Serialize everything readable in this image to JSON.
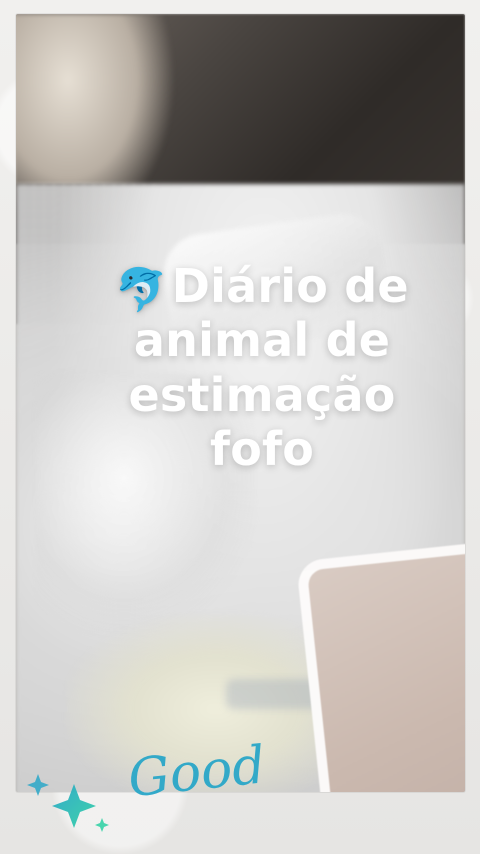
{
  "overlay": {
    "icon_name": "dolphin-icon",
    "icon_glyph": "🐬",
    "title_lines": [
      "Diário de",
      "animal de",
      "estimação",
      "fofo"
    ]
  },
  "decor": {
    "sparkles_icon_name": "sparkles-icon",
    "signature_text": "Good",
    "accent_color": "#2aa7c8"
  }
}
